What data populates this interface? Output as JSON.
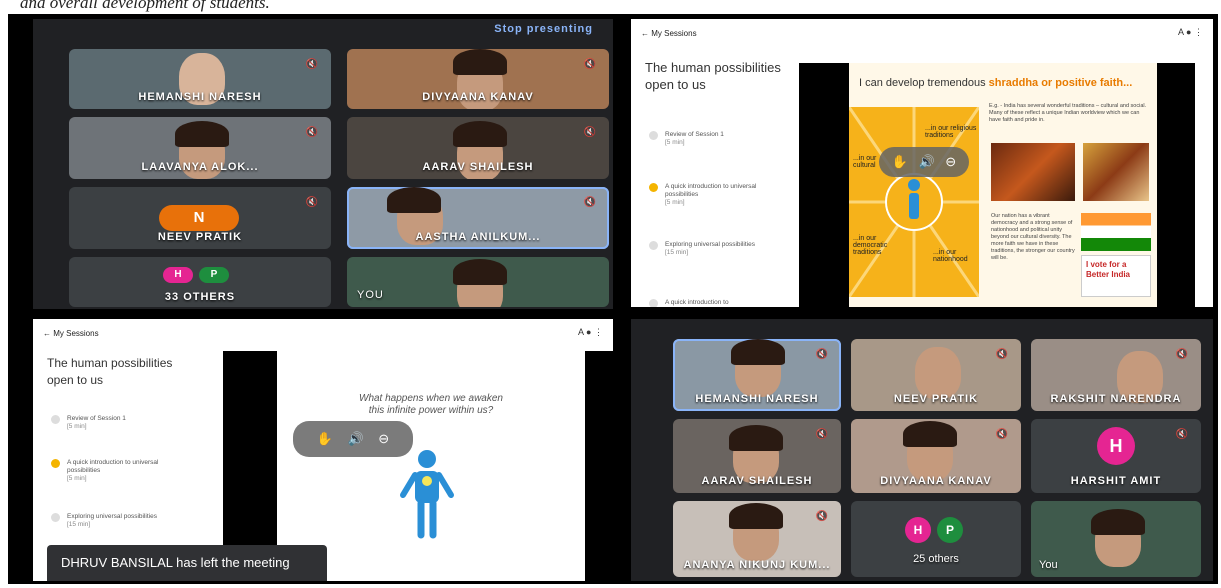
{
  "caption": "and overall development of students.",
  "top_left": {
    "stop_presenting": "Stop presenting",
    "tiles": [
      {
        "name": "HEMANSHI NARESH"
      },
      {
        "name": "DIVYAANA KANAV"
      },
      {
        "name": "LAAVANYA ALOK..."
      },
      {
        "name": "AARAV SHAILESH"
      },
      {
        "name": "NEEV PRATIK",
        "avatar": "N",
        "avatar_color": "#e8710a"
      },
      {
        "name": "AASTHA ANILKUM..."
      },
      {
        "name": "33 others",
        "avatars": [
          "H",
          "P"
        ]
      },
      {
        "name": "You"
      }
    ]
  },
  "top_right": {
    "back": "← My Sessions",
    "title": "The human possibilities open to us",
    "lessons": [
      {
        "title": "Review of Session 1",
        "duration": "[5 min]",
        "current": false
      },
      {
        "title": "A quick introduction to universal possibilities",
        "duration": "[5 min]",
        "current": true
      },
      {
        "title": "Exploring universal possibilities",
        "duration": "[15 min]",
        "current": false
      },
      {
        "title": "A quick introduction to",
        "duration": "",
        "current": false
      }
    ],
    "slide_heading_prefix": "I can develop tremendous ",
    "slide_heading_emphasis": "shraddha or positive faith...",
    "slide_labels": [
      "...in our religious traditions",
      "...in our cultural",
      "...in our democratic traditions",
      "...in our nationhood"
    ],
    "eg_text": "E.g. - India has several wonderful traditions – cultural and social. Many of these reflect a unique Indian worldview which we can have faith and pride in.",
    "nation_text": "Our nation has a vibrant democracy and a strong sense of nationhood and political unity beyond our cultural diversity. The more faith we have in these traditions, the stronger our country will be.",
    "vote_text": "I vote for a Better India"
  },
  "bottom_left": {
    "back": "← My Sessions",
    "title": "The human possibilities open to us",
    "lessons": [
      {
        "title": "Review of Session 1",
        "duration": "[5 min]",
        "current": false
      },
      {
        "title": "A quick introduction to universal possibilities",
        "duration": "[5 min]",
        "current": true
      },
      {
        "title": "Exploring universal possibilities",
        "duration": "[15 min]",
        "current": false
      }
    ],
    "slide_question": "What happens when we awaken this infinite power within us?",
    "toast": "DHRUV BANSILAL has left the meeting"
  },
  "bottom_right": {
    "tiles": [
      {
        "name": "HEMANSHI NARESH"
      },
      {
        "name": "NEEV PRATIK"
      },
      {
        "name": "RAKSHIT NARENDRA"
      },
      {
        "name": "AARAV SHAILESH"
      },
      {
        "name": "DIVYAANA KANAV"
      },
      {
        "name": "HARSHIT AMIT",
        "avatar": "H",
        "avatar_color": "#e52592"
      },
      {
        "name": "ANANYA NIKUNJ KUM..."
      },
      {
        "name": "25 others",
        "avatars": [
          "H",
          "P"
        ]
      },
      {
        "name": "You"
      }
    ]
  },
  "colors": {
    "meet_bg": "#202124",
    "tile_bg": "#3c4043",
    "active_outline": "#8ab4f8",
    "lesson_current": "#f4b400",
    "slide_yellow": "#f6b21a",
    "figure_blue": "#2a8fd6",
    "avatar_pink": "#e52592",
    "avatar_green": "#1e8e3e"
  }
}
